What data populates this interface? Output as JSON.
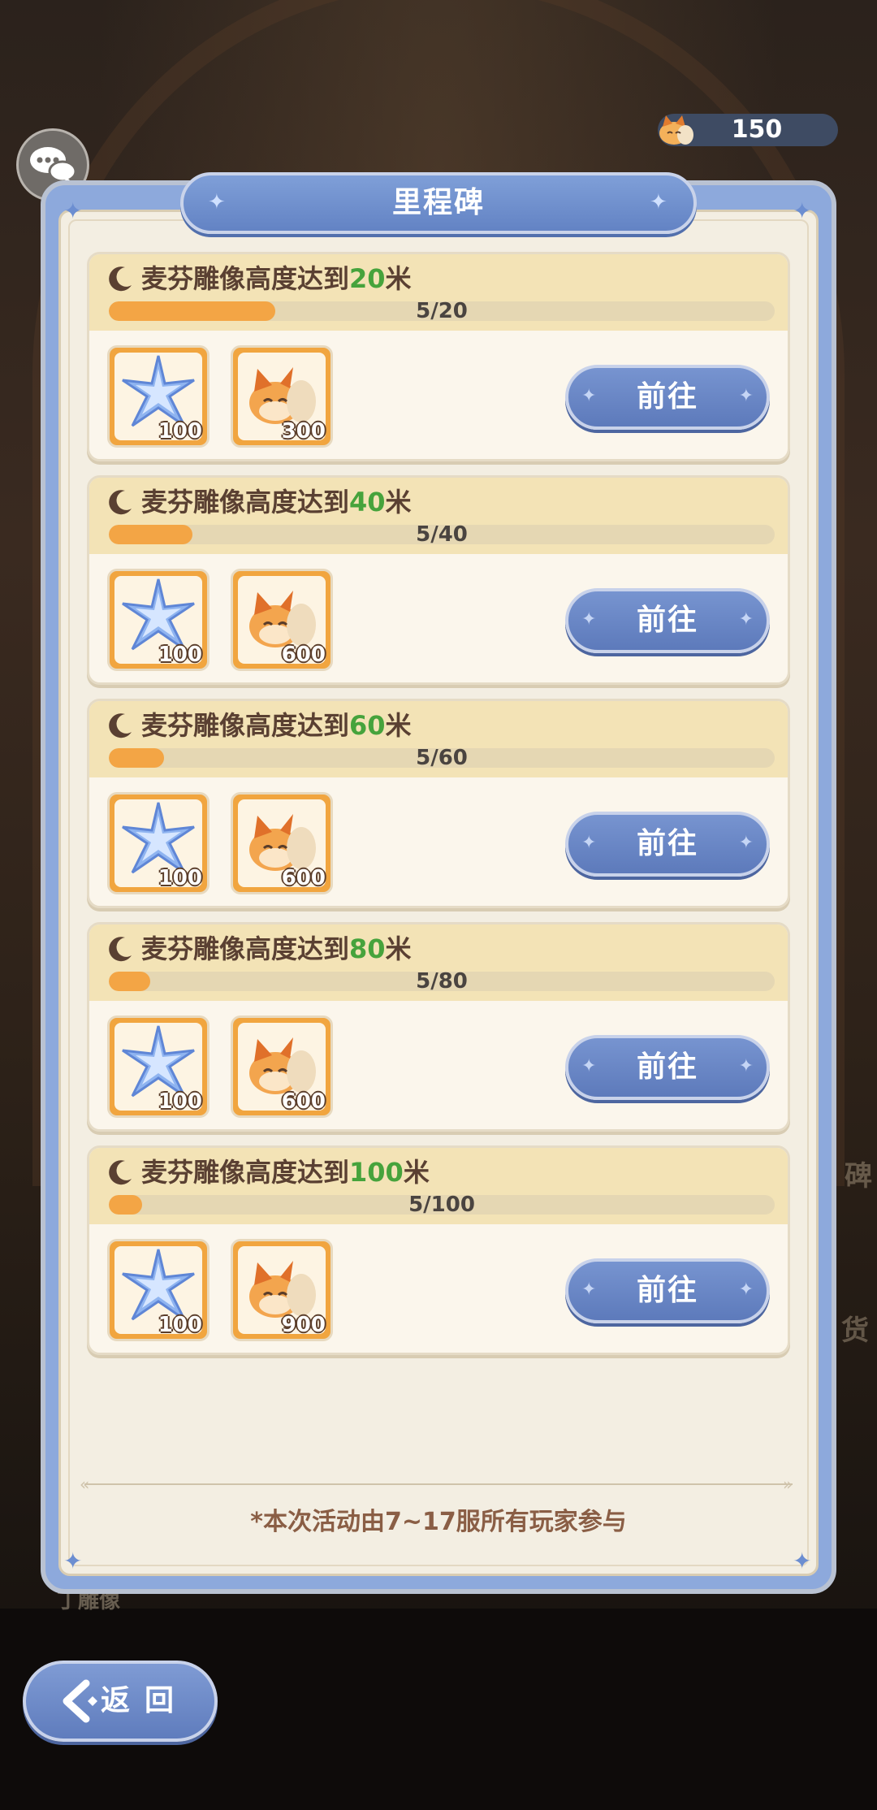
{
  "currency": {
    "icon": "fox-currency-icon",
    "value": "150"
  },
  "panel": {
    "title": "里程碑",
    "footnote": "*本次活动由7~17服所有玩家参与"
  },
  "milestones": [
    {
      "goal_prefix": "麦芬雕像高度达到",
      "goal_value": "20",
      "goal_unit": "米",
      "progress_text": "5/20",
      "progress_fraction": 0.25,
      "rewards": [
        {
          "icon": "star-crystal-icon",
          "count": "100"
        },
        {
          "icon": "fox-token-icon",
          "count": "300"
        }
      ],
      "button": "前往"
    },
    {
      "goal_prefix": "麦芬雕像高度达到",
      "goal_value": "40",
      "goal_unit": "米",
      "progress_text": "5/40",
      "progress_fraction": 0.125,
      "rewards": [
        {
          "icon": "star-crystal-icon",
          "count": "100"
        },
        {
          "icon": "fox-token-icon",
          "count": "600"
        }
      ],
      "button": "前往"
    },
    {
      "goal_prefix": "麦芬雕像高度达到",
      "goal_value": "60",
      "goal_unit": "米",
      "progress_text": "5/60",
      "progress_fraction": 0.083,
      "rewards": [
        {
          "icon": "star-crystal-icon",
          "count": "100"
        },
        {
          "icon": "fox-token-icon",
          "count": "600"
        }
      ],
      "button": "前往"
    },
    {
      "goal_prefix": "麦芬雕像高度达到",
      "goal_value": "80",
      "goal_unit": "米",
      "progress_text": "5/80",
      "progress_fraction": 0.0625,
      "rewards": [
        {
          "icon": "star-crystal-icon",
          "count": "100"
        },
        {
          "icon": "fox-token-icon",
          "count": "600"
        }
      ],
      "button": "前往"
    },
    {
      "goal_prefix": "麦芬雕像高度达到",
      "goal_value": "100",
      "goal_unit": "米",
      "progress_text": "5/100",
      "progress_fraction": 0.05,
      "rewards": [
        {
          "icon": "star-crystal-icon",
          "count": "100"
        },
        {
          "icon": "fox-token-icon",
          "count": "900"
        }
      ],
      "button": "前往"
    }
  ],
  "back_button": {
    "label": "返回"
  },
  "colors": {
    "panel_blue": "#8da9dc",
    "button_blue": "#6a87c6",
    "progress_orange": "#f3a545",
    "goal_number_green": "#46a33c",
    "card_header": "#f3e3b6"
  }
}
